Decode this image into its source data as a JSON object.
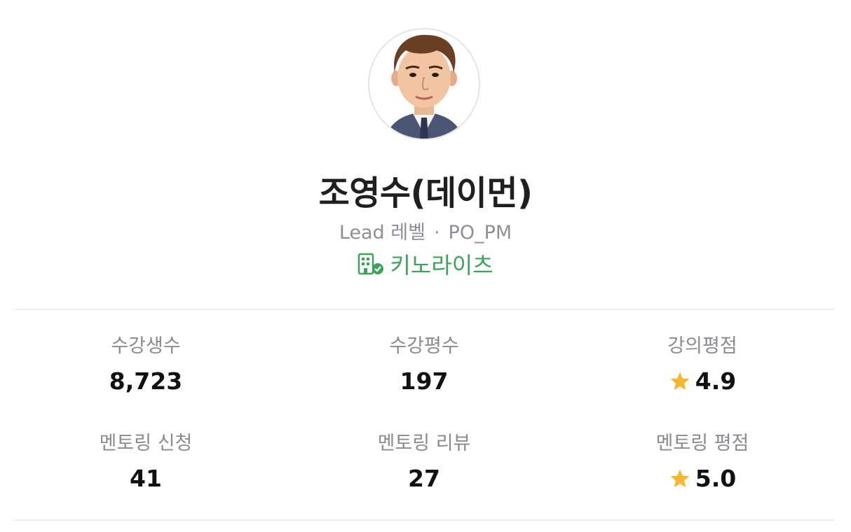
{
  "profile": {
    "name": "조영수(데이먼)",
    "level": "Lead 레벨",
    "separator": "·",
    "role": "PO_PM",
    "company": "키노라이츠",
    "company_icon": "building-check-icon",
    "accent_color": "#3ea35a"
  },
  "stats": [
    {
      "label": "수강생수",
      "value": "8,723"
    },
    {
      "label": "수강평수",
      "value": "197"
    },
    {
      "label": "강의평점",
      "value": "4.9",
      "icon": "star-icon"
    },
    {
      "label": "멘토링 신청",
      "value": "41"
    },
    {
      "label": "멘토링 리뷰",
      "value": "27"
    },
    {
      "label": "멘토링 평점",
      "value": "5.0",
      "icon": "star-icon"
    }
  ],
  "star_color": "#f5b731"
}
